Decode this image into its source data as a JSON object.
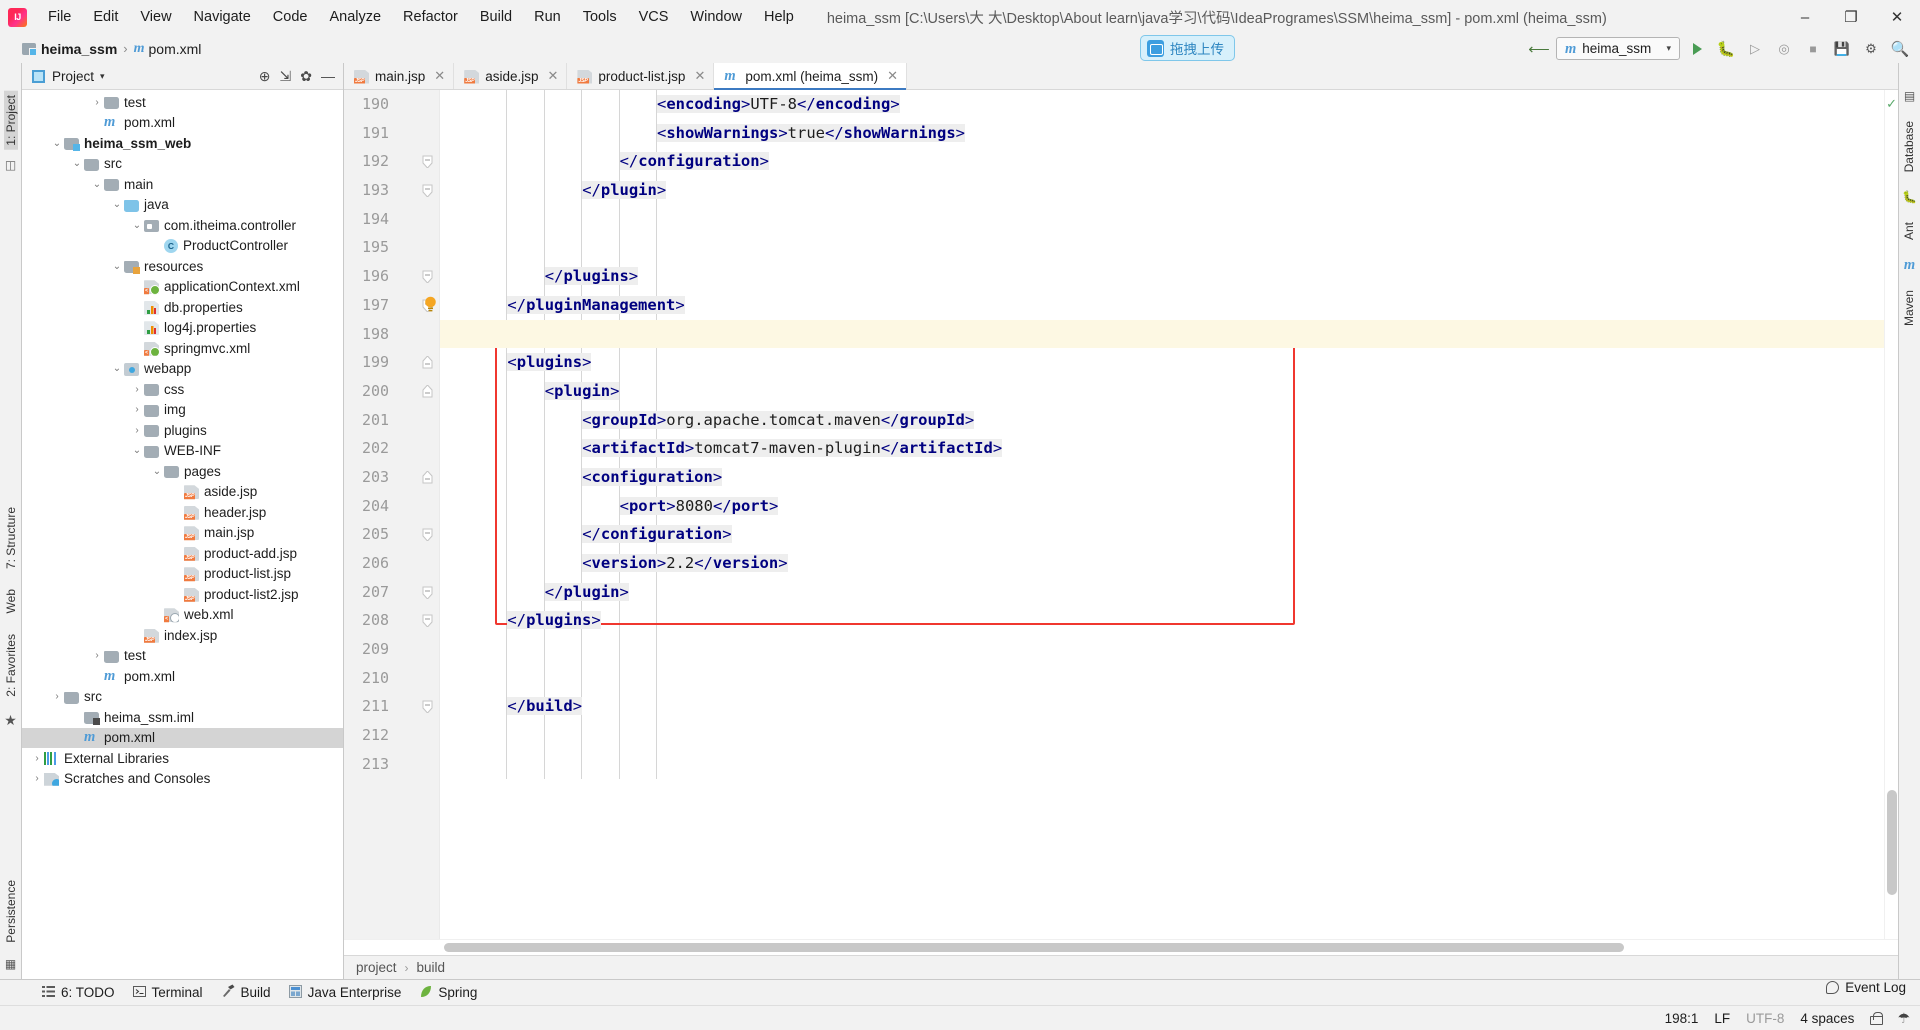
{
  "window": {
    "title": "heima_ssm [C:\\Users\\大 大\\Desktop\\About learn\\java学习\\代码\\IdeaProgrames\\SSM\\heima_ssm] - pom.xml (heima_ssm)",
    "minimize": "–",
    "maximize": "❐",
    "close": "✕"
  },
  "menubar": {
    "items": [
      "File",
      "Edit",
      "View",
      "Navigate",
      "Code",
      "Analyze",
      "Refactor",
      "Build",
      "Run",
      "Tools",
      "VCS",
      "Window",
      "Help"
    ]
  },
  "breadcrumb": {
    "project": "heima_ssm",
    "separator": "›",
    "file": "pom.xml",
    "maven_glyph": "m"
  },
  "upload_chip": {
    "label": "拖拽上传"
  },
  "nav_right": {
    "run_config": "heima_ssm",
    "run_title": "Run",
    "debug_title": "Debug",
    "stop_title": "Stop",
    "search_title": "Search Everywhere",
    "hammer_title": "Build Project"
  },
  "left_strip": {
    "project_tab": "1: Project",
    "structure_tab": "7: Structure",
    "web_tab": "Web",
    "favorites_tab": "2: Favorites",
    "persistence_tab": "Persistence"
  },
  "right_strip": {
    "database_tab": "Database",
    "ant_tab": "Ant",
    "maven_tab": "Maven"
  },
  "project_panel": {
    "title": "Project",
    "caret": "▾",
    "locate_icon": "⊕",
    "collapse_icon": "⇲",
    "settings_icon": "✿",
    "hide_icon": "—",
    "tree": [
      {
        "label": "test",
        "indent": 3,
        "arrow": "›",
        "icon": "folder",
        "bold": false,
        "selected": false
      },
      {
        "label": "pom.xml",
        "indent": 3,
        "arrow": "",
        "icon": "maven",
        "bold": false,
        "selected": false
      },
      {
        "label": "heima_ssm_web",
        "indent": 1,
        "arrow": "⌄",
        "icon": "module",
        "bold": true,
        "selected": false
      },
      {
        "label": "src",
        "indent": 2,
        "arrow": "⌄",
        "icon": "folder",
        "bold": false,
        "selected": false
      },
      {
        "label": "main",
        "indent": 3,
        "arrow": "⌄",
        "icon": "folder",
        "bold": false,
        "selected": false
      },
      {
        "label": "java",
        "indent": 4,
        "arrow": "⌄",
        "icon": "folder-blue",
        "bold": false,
        "selected": false
      },
      {
        "label": "com.itheima.controller",
        "indent": 5,
        "arrow": "⌄",
        "icon": "package",
        "bold": false,
        "selected": false
      },
      {
        "label": "ProductController",
        "indent": 6,
        "arrow": "",
        "icon": "class",
        "bold": false,
        "selected": false
      },
      {
        "label": "resources",
        "indent": 4,
        "arrow": "⌄",
        "icon": "resources",
        "bold": false,
        "selected": false
      },
      {
        "label": "applicationContext.xml",
        "indent": 5,
        "arrow": "",
        "icon": "spring-xml",
        "bold": false,
        "selected": false
      },
      {
        "label": "db.properties",
        "indent": 5,
        "arrow": "",
        "icon": "properties",
        "bold": false,
        "selected": false
      },
      {
        "label": "log4j.properties",
        "indent": 5,
        "arrow": "",
        "icon": "properties",
        "bold": false,
        "selected": false
      },
      {
        "label": "springmvc.xml",
        "indent": 5,
        "arrow": "",
        "icon": "spring-xml",
        "bold": false,
        "selected": false
      },
      {
        "label": "webapp",
        "indent": 4,
        "arrow": "⌄",
        "icon": "webapp",
        "bold": false,
        "selected": false
      },
      {
        "label": "css",
        "indent": 5,
        "arrow": "›",
        "icon": "folder",
        "bold": false,
        "selected": false
      },
      {
        "label": "img",
        "indent": 5,
        "arrow": "›",
        "icon": "folder",
        "bold": false,
        "selected": false
      },
      {
        "label": "plugins",
        "indent": 5,
        "arrow": "›",
        "icon": "folder",
        "bold": false,
        "selected": false
      },
      {
        "label": "WEB-INF",
        "indent": 5,
        "arrow": "⌄",
        "icon": "folder",
        "bold": false,
        "selected": false
      },
      {
        "label": "pages",
        "indent": 6,
        "arrow": "⌄",
        "icon": "folder",
        "bold": false,
        "selected": false
      },
      {
        "label": "aside.jsp",
        "indent": 7,
        "arrow": "",
        "icon": "jsp",
        "bold": false,
        "selected": false
      },
      {
        "label": "header.jsp",
        "indent": 7,
        "arrow": "",
        "icon": "jsp",
        "bold": false,
        "selected": false
      },
      {
        "label": "main.jsp",
        "indent": 7,
        "arrow": "",
        "icon": "jsp",
        "bold": false,
        "selected": false
      },
      {
        "label": "product-add.jsp",
        "indent": 7,
        "arrow": "",
        "icon": "jsp",
        "bold": false,
        "selected": false
      },
      {
        "label": "product-list.jsp",
        "indent": 7,
        "arrow": "",
        "icon": "jsp",
        "bold": false,
        "selected": false
      },
      {
        "label": "product-list2.jsp",
        "indent": 7,
        "arrow": "",
        "icon": "jsp",
        "bold": false,
        "selected": false
      },
      {
        "label": "web.xml",
        "indent": 6,
        "arrow": "",
        "icon": "web-xml",
        "bold": false,
        "selected": false
      },
      {
        "label": "index.jsp",
        "indent": 5,
        "arrow": "",
        "icon": "jsp",
        "bold": false,
        "selected": false
      },
      {
        "label": "test",
        "indent": 3,
        "arrow": "›",
        "icon": "folder",
        "bold": false,
        "selected": false
      },
      {
        "label": "pom.xml",
        "indent": 3,
        "arrow": "",
        "icon": "maven",
        "bold": false,
        "selected": false
      },
      {
        "label": "src",
        "indent": 1,
        "arrow": "›",
        "icon": "folder",
        "bold": false,
        "selected": false
      },
      {
        "label": "heima_ssm.iml",
        "indent": 2,
        "arrow": "",
        "icon": "iml",
        "bold": false,
        "selected": false
      },
      {
        "label": "pom.xml",
        "indent": 2,
        "arrow": "",
        "icon": "maven",
        "bold": false,
        "selected": true
      },
      {
        "label": "External Libraries",
        "indent": 0,
        "arrow": "›",
        "icon": "library",
        "bold": false,
        "selected": false
      },
      {
        "label": "Scratches and Consoles",
        "indent": 0,
        "arrow": "›",
        "icon": "scratch",
        "bold": false,
        "selected": false
      }
    ]
  },
  "editor": {
    "tabs": [
      {
        "label": "main.jsp",
        "icon": "jsp",
        "active": false,
        "close": "✕"
      },
      {
        "label": "aside.jsp",
        "icon": "jsp",
        "active": false,
        "close": "✕"
      },
      {
        "label": "product-list.jsp",
        "icon": "jsp",
        "active": false,
        "close": "✕"
      },
      {
        "label": "pom.xml (heima_ssm)",
        "icon": "maven",
        "active": true,
        "close": "✕"
      }
    ],
    "first_line_number": 190,
    "lines": [
      {
        "num": 190,
        "indent": 5,
        "fold": "",
        "text_runs": [
          {
            "t": "<",
            "k": "punc"
          },
          {
            "t": "encoding",
            "k": "tag"
          },
          {
            "t": ">",
            "k": "punc"
          },
          {
            "t": "UTF-8",
            "k": "txt"
          },
          {
            "t": "</",
            "k": "punc"
          },
          {
            "t": "encoding",
            "k": "tag"
          },
          {
            "t": ">",
            "k": "punc"
          }
        ]
      },
      {
        "num": 191,
        "indent": 5,
        "fold": "",
        "text_runs": [
          {
            "t": "<",
            "k": "punc"
          },
          {
            "t": "showWarnings",
            "k": "tag"
          },
          {
            "t": ">",
            "k": "punc"
          },
          {
            "t": "true",
            "k": "txt"
          },
          {
            "t": "</",
            "k": "punc"
          },
          {
            "t": "showWarnings",
            "k": "tag"
          },
          {
            "t": ">",
            "k": "punc"
          }
        ]
      },
      {
        "num": 192,
        "indent": 4,
        "fold": "end",
        "text_runs": [
          {
            "t": "</",
            "k": "punc"
          },
          {
            "t": "configuration",
            "k": "tag"
          },
          {
            "t": ">",
            "k": "punc"
          }
        ]
      },
      {
        "num": 193,
        "indent": 3,
        "fold": "end",
        "text_runs": [
          {
            "t": "</",
            "k": "punc"
          },
          {
            "t": "plugin",
            "k": "tag"
          },
          {
            "t": ">",
            "k": "punc"
          }
        ]
      },
      {
        "num": 194,
        "indent": 0,
        "fold": "",
        "text_runs": []
      },
      {
        "num": 195,
        "indent": 0,
        "fold": "",
        "text_runs": []
      },
      {
        "num": 196,
        "indent": 2,
        "fold": "end",
        "text_runs": [
          {
            "t": "</",
            "k": "punc"
          },
          {
            "t": "plugins",
            "k": "tag"
          },
          {
            "t": ">",
            "k": "punc"
          }
        ]
      },
      {
        "num": 197,
        "indent": 1,
        "fold": "end",
        "bulb": true,
        "text_runs": [
          {
            "t": "</",
            "k": "punc"
          },
          {
            "t": "pluginManagement",
            "k": "tag"
          },
          {
            "t": ">",
            "k": "punc"
          }
        ]
      },
      {
        "num": 198,
        "indent": 0,
        "fold": "",
        "current": true,
        "text_runs": []
      },
      {
        "num": 199,
        "indent": 1,
        "fold": "start",
        "text_runs": [
          {
            "t": "<",
            "k": "punc"
          },
          {
            "t": "plugins",
            "k": "tag"
          },
          {
            "t": ">",
            "k": "punc"
          }
        ]
      },
      {
        "num": 200,
        "indent": 2,
        "fold": "start",
        "text_runs": [
          {
            "t": "<",
            "k": "punc"
          },
          {
            "t": "plugin",
            "k": "tag"
          },
          {
            "t": ">",
            "k": "punc"
          }
        ]
      },
      {
        "num": 201,
        "indent": 3,
        "fold": "",
        "text_runs": [
          {
            "t": "<",
            "k": "punc"
          },
          {
            "t": "groupId",
            "k": "tag"
          },
          {
            "t": ">",
            "k": "punc"
          },
          {
            "t": "org.apache.tomcat.maven",
            "k": "txt"
          },
          {
            "t": "</",
            "k": "punc"
          },
          {
            "t": "groupId",
            "k": "tag"
          },
          {
            "t": ">",
            "k": "punc"
          }
        ]
      },
      {
        "num": 202,
        "indent": 3,
        "fold": "",
        "text_runs": [
          {
            "t": "<",
            "k": "punc"
          },
          {
            "t": "artifactId",
            "k": "tag"
          },
          {
            "t": ">",
            "k": "punc"
          },
          {
            "t": "tomcat7-maven-plugin",
            "k": "txt"
          },
          {
            "t": "</",
            "k": "punc"
          },
          {
            "t": "artifactId",
            "k": "tag"
          },
          {
            "t": ">",
            "k": "punc"
          }
        ]
      },
      {
        "num": 203,
        "indent": 3,
        "fold": "start",
        "text_runs": [
          {
            "t": "<",
            "k": "punc"
          },
          {
            "t": "configuration",
            "k": "tag"
          },
          {
            "t": ">",
            "k": "punc"
          }
        ]
      },
      {
        "num": 204,
        "indent": 4,
        "fold": "",
        "text_runs": [
          {
            "t": "<",
            "k": "punc"
          },
          {
            "t": "port",
            "k": "tag"
          },
          {
            "t": ">",
            "k": "punc"
          },
          {
            "t": "8080",
            "k": "txt"
          },
          {
            "t": "</",
            "k": "punc"
          },
          {
            "t": "port",
            "k": "tag"
          },
          {
            "t": ">",
            "k": "punc"
          }
        ]
      },
      {
        "num": 205,
        "indent": 3,
        "fold": "end",
        "text_runs": [
          {
            "t": "</",
            "k": "punc"
          },
          {
            "t": "configuration",
            "k": "tag"
          },
          {
            "t": ">",
            "k": "punc"
          }
        ]
      },
      {
        "num": 206,
        "indent": 3,
        "fold": "",
        "text_runs": [
          {
            "t": "<",
            "k": "punc"
          },
          {
            "t": "version",
            "k": "tag"
          },
          {
            "t": ">",
            "k": "punc"
          },
          {
            "t": "2.2",
            "k": "txt"
          },
          {
            "t": "</",
            "k": "punc"
          },
          {
            "t": "version",
            "k": "tag"
          },
          {
            "t": ">",
            "k": "punc"
          }
        ]
      },
      {
        "num": 207,
        "indent": 2,
        "fold": "end",
        "text_runs": [
          {
            "t": "</",
            "k": "punc"
          },
          {
            "t": "plugin",
            "k": "tag"
          },
          {
            "t": ">",
            "k": "punc"
          }
        ]
      },
      {
        "num": 208,
        "indent": 1,
        "fold": "end",
        "text_runs": [
          {
            "t": "</",
            "k": "punc"
          },
          {
            "t": "plugins",
            "k": "tag"
          },
          {
            "t": ">",
            "k": "punc"
          }
        ]
      },
      {
        "num": 209,
        "indent": 0,
        "fold": "",
        "text_runs": []
      },
      {
        "num": 210,
        "indent": 0,
        "fold": "",
        "text_runs": []
      },
      {
        "num": 211,
        "indent": 1,
        "fold": "end",
        "text_runs": [
          {
            "t": "</",
            "k": "punc"
          },
          {
            "t": "build",
            "k": "tag"
          },
          {
            "t": ">",
            "k": "punc"
          }
        ]
      },
      {
        "num": 212,
        "indent": 0,
        "fold": "",
        "text_runs": []
      },
      {
        "num": 213,
        "indent": 0,
        "fold": "",
        "text_runs": []
      }
    ],
    "breadcrumb": {
      "project": "project",
      "sep": "›",
      "build": "build"
    }
  },
  "bottom_toolwindows": [
    {
      "label": "6: TODO",
      "icon": "list-icon"
    },
    {
      "label": "Terminal",
      "icon": "terminal-icon"
    },
    {
      "label": "Build",
      "icon": "hammer-icon"
    },
    {
      "label": "Java Enterprise",
      "icon": "java-ee-icon"
    },
    {
      "label": "Spring",
      "icon": "spring-leaf-icon"
    }
  ],
  "statusbar": {
    "event_log": "Event Log",
    "caret_position": "198:1",
    "line_separator": "LF",
    "encoding": "UTF-8",
    "indent": "4 spaces",
    "lock_title": "Toggle read-only",
    "hat_title": "Hector"
  },
  "colors": {
    "accent_tab": "#3c7ac2",
    "red_highlight": "#f0372f",
    "current_line": "#fdf8e3",
    "tag": "#000080",
    "selection_bg": "#d4d4d4"
  }
}
